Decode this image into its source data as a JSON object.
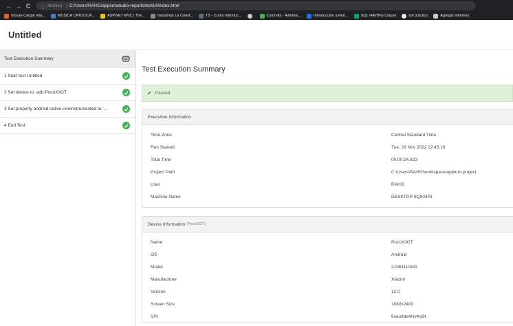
{
  "browser": {
    "nav": {
      "back": "←",
      "forward": "→",
      "reload": "C"
    },
    "address": {
      "scheme": "Archivo",
      "sep": "|",
      "url": "C:/Users/RAHG/appiumstudio-reports/test14/index.html"
    },
    "bookmarks": [
      {
        "label": "mouse Cargar ima...",
        "color": "#e8612c"
      },
      {
        "label": "MUSICA CATOLICA...",
        "color": "#4a7bd0"
      },
      {
        "label": "ASP.NET MVC | The...",
        "color": "#f1c40f"
      },
      {
        "label": "Industrias La Const...",
        "color": "#8a8a8a"
      },
      {
        "label": "TS - Curso Introduc...",
        "color": "#5f6b7a"
      },
      {
        "label": "",
        "color": "#cccccc"
      },
      {
        "label": "Commits · Adminis...",
        "color": "#3fb34f"
      },
      {
        "label": "Introducción a Rub...",
        "color": "#1a73e8"
      },
      {
        "label": "SQL HAVING Clause",
        "color": "#04aa6d"
      },
      {
        "label": "Git práctico",
        "color": "#e8eaed"
      },
      {
        "label": "Agregar informes",
        "color": "#c9c9c9"
      }
    ]
  },
  "app": {
    "title": "Untitled"
  },
  "sidebar": {
    "items": [
      {
        "label": "Test Execution Summary",
        "status": "summary"
      },
      {
        "label": "1 Start test Untitled",
        "status": "passed"
      },
      {
        "label": "2 Set device to: adb:PocoX3GT",
        "status": "passed"
      },
      {
        "label": "3 Set property android.native.nonInstrumented to: ...",
        "status": "passed"
      },
      {
        "label": "4 End Test",
        "status": "passed"
      }
    ]
  },
  "main": {
    "title": "Test Execution Summary",
    "status": {
      "check": "✔",
      "label": "Passed"
    },
    "execution": {
      "heading": "Execution Information",
      "rows": [
        {
          "k": "Time Zone",
          "v": "Central Standard Time"
        },
        {
          "k": "Run Started",
          "v": "Tue, 29 Nov 2022 22:45:16"
        },
        {
          "k": "Total Time",
          "v": "00:00:24.823"
        },
        {
          "k": "Project Path",
          "v": "C:\\Users\\RAHG\\workspace\\appium-project"
        },
        {
          "k": "User",
          "v": "RAHG"
        },
        {
          "k": "Machine Name",
          "v": "DESKTOP-8Q904RI"
        }
      ]
    },
    "device": {
      "heading": "Device Information",
      "sub": "(PocoX3GT)",
      "rows": [
        {
          "k": "Name",
          "v": "PocoX3GT"
        },
        {
          "k": "OS",
          "v": "Android"
        },
        {
          "k": "Model",
          "v": "21061110AG"
        },
        {
          "k": "Manufacturer",
          "v": "Xiaomi"
        },
        {
          "k": "Version",
          "v": "12.0"
        },
        {
          "k": "Screen Size",
          "v": "1080x2400"
        },
        {
          "k": "S/N",
          "v": "8xeu9dx4hiv4nj8t"
        }
      ]
    }
  }
}
